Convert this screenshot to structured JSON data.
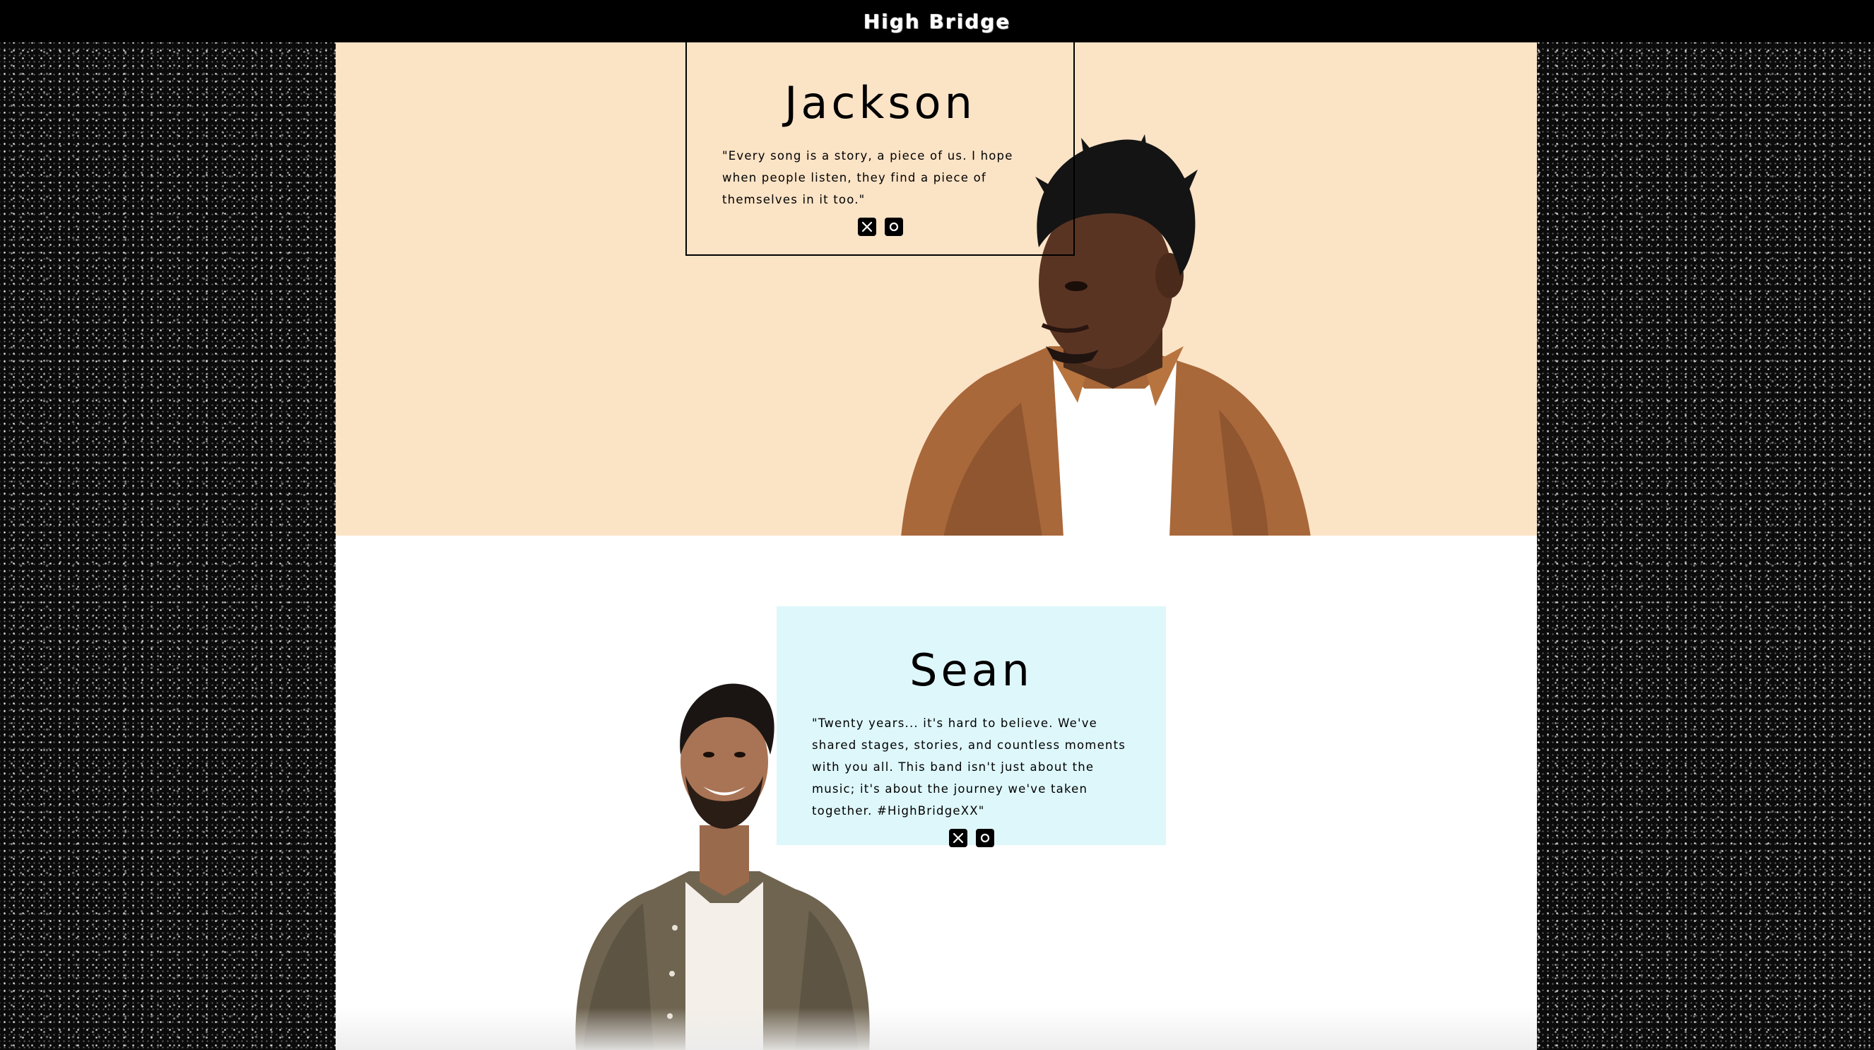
{
  "header": {
    "brand": "High Bridge"
  },
  "members": {
    "jackson": {
      "name": "Jackson",
      "quote": "\"Every song is a story, a piece of us. I hope when people listen, they find a piece of themselves in it too.\"",
      "section_color": "#fbe3c6",
      "socials": [
        "x-icon",
        "instagram-icon"
      ]
    },
    "sean": {
      "name": "Sean",
      "quote": "\"Twenty years... it's hard to believe. We've shared stages, stories, and countless moments with you all. This band isn't just about the music; it's about the journey we've taken together. #HighBridgeXX\"",
      "card_color": "#def7fb",
      "socials": [
        "x-icon",
        "instagram-icon"
      ]
    }
  },
  "colors": {
    "topbar": "#000000",
    "page_background": "#0b0b0b",
    "content_background": "#ffffff"
  }
}
